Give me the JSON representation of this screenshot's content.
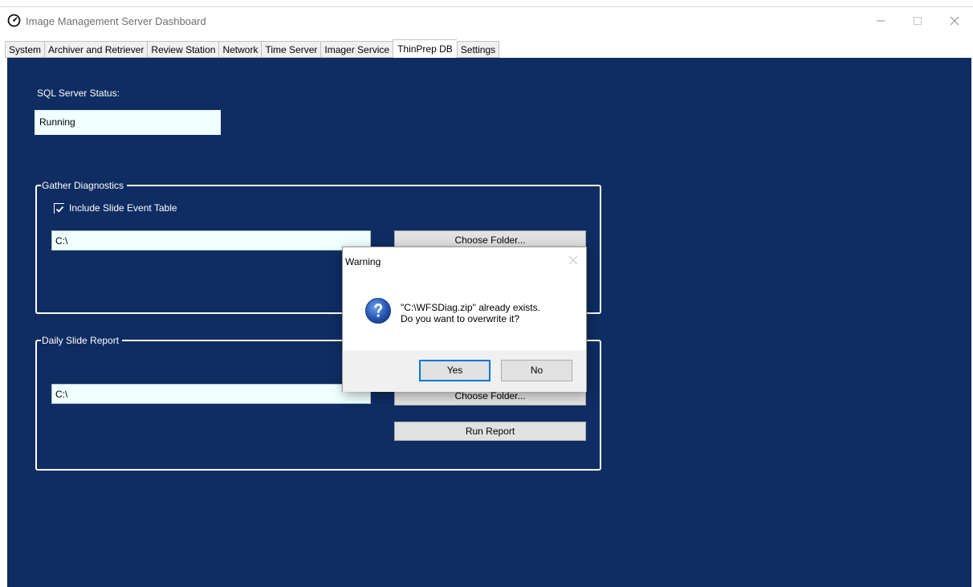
{
  "window": {
    "title": "Image Management Server Dashboard",
    "app_icon": "gauge-icon"
  },
  "tabs": [
    {
      "label": "System"
    },
    {
      "label": "Archiver and Retriever"
    },
    {
      "label": "Review Station"
    },
    {
      "label": "Network"
    },
    {
      "label": "Time Server"
    },
    {
      "label": "Imager Service"
    },
    {
      "label": "ThinPrep DB",
      "active": true
    },
    {
      "label": "Settings"
    }
  ],
  "sql": {
    "label": "SQL Server Status:",
    "value": "Running"
  },
  "gather_diagnostics": {
    "legend": "Gather Diagnostics",
    "checkbox_label": "Include Slide Event Table",
    "checked": true,
    "path": "C:\\",
    "choose_folder": "Choose Folder..."
  },
  "daily_report": {
    "legend": "Daily Slide Report",
    "path": "C:\\",
    "choose_folder": "Choose Folder...",
    "run_report": "Run Report"
  },
  "dialog": {
    "title": "Warning",
    "icon": "question-icon",
    "message_line1": "\"C:\\WFSDiag.zip\" already exists.",
    "message_line2": "Do you want to overwrite it?",
    "yes": "Yes",
    "no": "No"
  },
  "colors": {
    "panel_bg": "#0f2d62",
    "field_bg": "#f0ffff",
    "accent": "#0078d7"
  }
}
